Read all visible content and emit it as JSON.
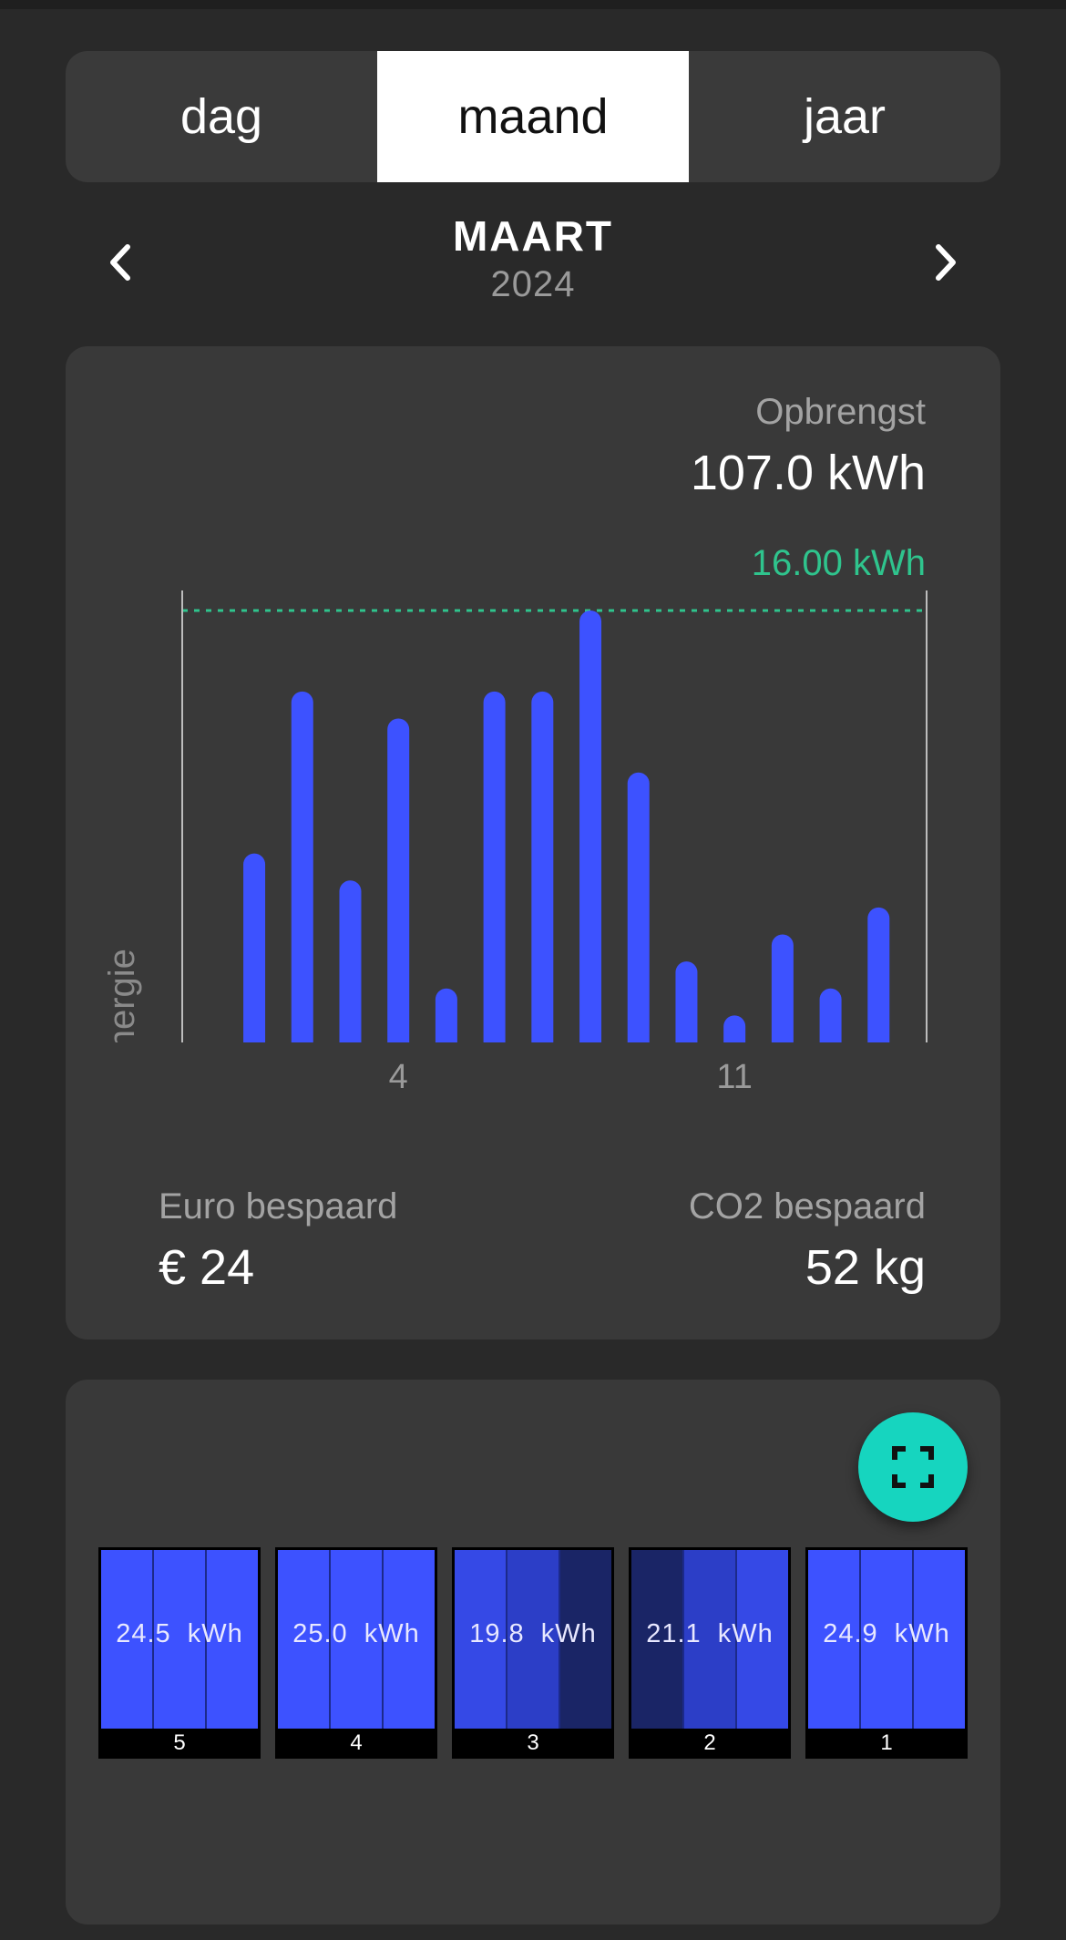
{
  "tabs": [
    {
      "label": "dag",
      "active": false
    },
    {
      "label": "maand",
      "active": true
    },
    {
      "label": "jaar",
      "active": false
    }
  ],
  "period": {
    "month": "MAART",
    "year": "2024"
  },
  "summary": {
    "yield_label": "Opbrengst",
    "yield_value": "107.0 kWh",
    "max_label": "16.00 kWh",
    "euro_label": "Euro bespaard",
    "euro_value": "€ 24",
    "co2_label": "CO2 bespaard",
    "co2_value": "52 kg"
  },
  "chart_data": {
    "type": "bar",
    "ylabel": "Energie",
    "max_line": 16.0,
    "ylim": [
      0,
      16
    ],
    "tick_labels": [
      {
        "day": 4,
        "label": "4"
      },
      {
        "day": 11,
        "label": "11"
      }
    ],
    "x": [
      1,
      2,
      3,
      4,
      5,
      6,
      7,
      8,
      9,
      10,
      11,
      12,
      13,
      14
    ],
    "values": [
      7.0,
      13.0,
      6.0,
      12.0,
      2.0,
      13.0,
      13.0,
      16.0,
      10.0,
      3.0,
      1.0,
      4.0,
      2.0,
      5.0
    ],
    "x_range": [
      -0.5,
      15.0
    ],
    "bar_color": "#3d52ff",
    "max_line_color": "#2fc48d"
  },
  "panels": [
    {
      "value": "24.5",
      "unit": "kWh",
      "label": "5",
      "shades": [
        "#3d52ff",
        "#3d52ff",
        "#3d52ff"
      ]
    },
    {
      "value": "25.0",
      "unit": "kWh",
      "label": "4",
      "shades": [
        "#3d52ff",
        "#3d52ff",
        "#3d52ff"
      ]
    },
    {
      "value": "19.8",
      "unit": "kWh",
      "label": "3",
      "shades": [
        "#3549e6",
        "#2c3ec7",
        "#1a2566"
      ]
    },
    {
      "value": "21.1",
      "unit": "kWh",
      "label": "2",
      "shades": [
        "#1a2566",
        "#2c3ec7",
        "#3549e6"
      ]
    },
    {
      "value": "24.9",
      "unit": "kWh",
      "label": "1",
      "shades": [
        "#3d52ff",
        "#3d52ff",
        "#3d52ff"
      ]
    }
  ]
}
